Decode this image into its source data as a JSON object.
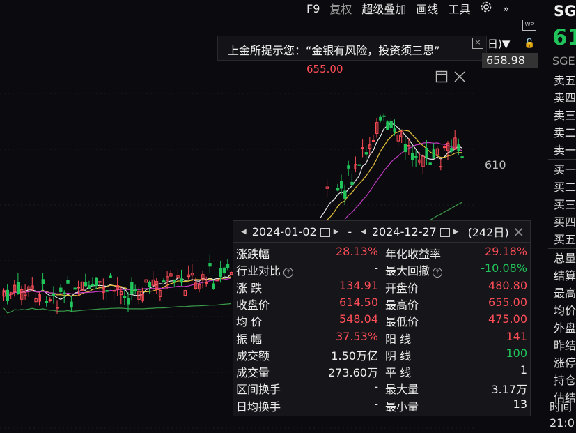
{
  "toolbar": {
    "f9": "F9",
    "restore": "复权",
    "overlay": "超级叠加",
    "draw": "画线",
    "tools": "工具",
    "more": "»"
  },
  "notice": {
    "text": "上金所提示您：“金银有风险，投资须三思”"
  },
  "period_selector": {
    "label": "日)▼"
  },
  "chart": {
    "current_price_label": "658.98",
    "axis_label_610": "610",
    "peak_label": "655.00",
    "up_color": "#ff4d57",
    "down_color": "#21c45b"
  },
  "right_panel": {
    "symbol": "SG",
    "price": "61",
    "exchange": "SGE",
    "order_book": [
      "卖五",
      "卖四",
      "卖三",
      "卖二",
      "卖一",
      "买一",
      "买二",
      "买三",
      "买四",
      "买五"
    ],
    "info": [
      "总量",
      "结算",
      "最高",
      "均价",
      "外盘",
      "昨结",
      "涨停",
      "持仓",
      "估结"
    ],
    "time_header": "时间",
    "time_value": "21:0"
  },
  "stats": {
    "start_date": "2024-01-02",
    "end_date": "2024-12-27",
    "sep": "-",
    "days": "(242日)",
    "left": [
      {
        "label": "涨跌幅",
        "value": "28.13%",
        "color": "red"
      },
      {
        "label": "行业对比",
        "value": "-",
        "color": "white",
        "help": true
      },
      {
        "label": "涨  跌",
        "value": "134.91",
        "color": "red"
      },
      {
        "label": "收盘价",
        "value": "614.50",
        "color": "red"
      },
      {
        "label": "均  价",
        "value": "548.04",
        "color": "red"
      },
      {
        "label": "振  幅",
        "value": "37.53%",
        "color": "red"
      },
      {
        "label": "成交额",
        "value": "1.50万亿",
        "color": "white"
      },
      {
        "label": "成交量",
        "value": "273.60万",
        "color": "white"
      },
      {
        "label": "区间换手",
        "value": "-",
        "color": "white"
      },
      {
        "label": "日均换手",
        "value": "-",
        "color": "white"
      }
    ],
    "right": [
      {
        "label": "年化收益率",
        "value": "29.18%",
        "color": "red"
      },
      {
        "label": "最大回撤",
        "value": "-10.08%",
        "color": "green",
        "help": true
      },
      {
        "label": "开盘价",
        "value": "480.80",
        "color": "red"
      },
      {
        "label": "最高价",
        "value": "655.00",
        "color": "red"
      },
      {
        "label": "最低价",
        "value": "475.00",
        "color": "red"
      },
      {
        "label": "阳  线",
        "value": "141",
        "color": "red"
      },
      {
        "label": "阴  线",
        "value": "100",
        "color": "green"
      },
      {
        "label": "平  线",
        "value": "1",
        "color": "white"
      },
      {
        "label": "最大量",
        "value": "3.17万",
        "color": "white"
      },
      {
        "label": "最小量",
        "value": "13",
        "color": "white"
      }
    ]
  }
}
